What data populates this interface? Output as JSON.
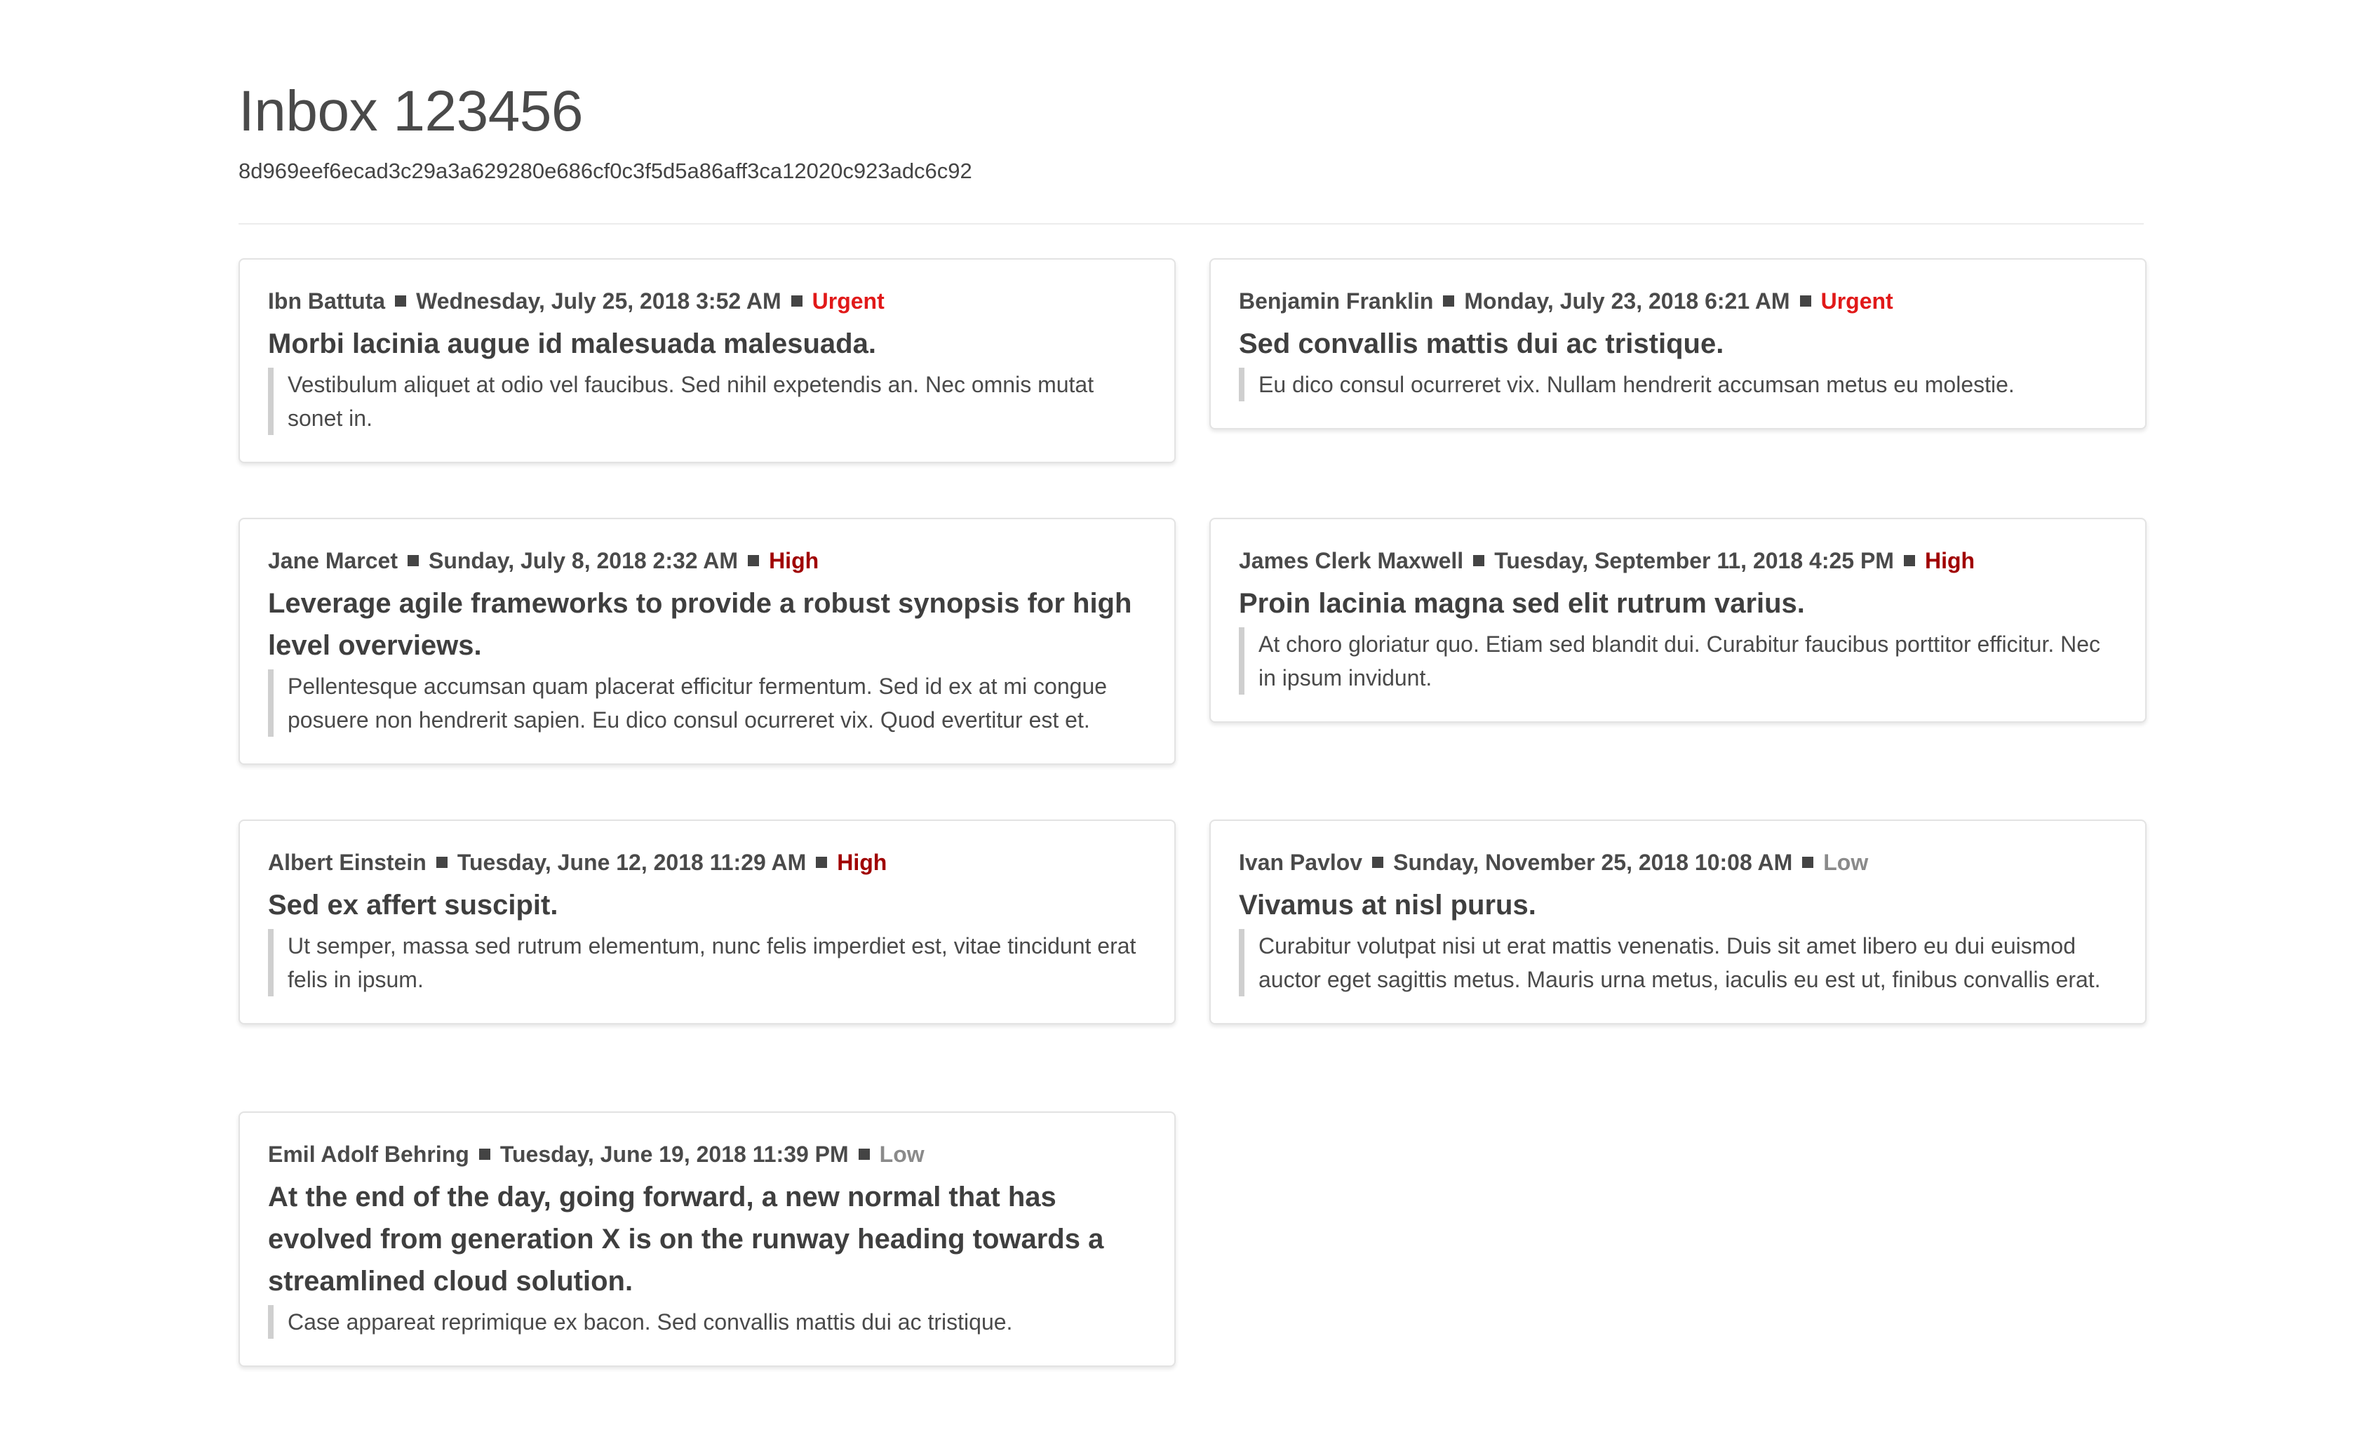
{
  "inbox": {
    "title": "Inbox 123456",
    "id": "8d969eef6ecad3c29a3a629280e686cf0c3f5d5a86aff3ca12020c923adc6c92"
  },
  "colors": {
    "urgent": "#e11919",
    "high": "#a00000",
    "low": "#8a8a8a"
  },
  "messages": [
    {
      "sender": "Ibn Battuta",
      "date": "Wednesday, July 25, 2018 3:52 AM",
      "priority": "Urgent",
      "subject": "Morbi lacinia augue id malesuada malesuada.",
      "snippet": "Vestibulum aliquet at odio vel faucibus. Sed nihil expetendis an. Nec omnis mutat sonet in."
    },
    {
      "sender": "Benjamin Franklin",
      "date": "Monday, July 23, 2018 6:21 AM",
      "priority": "Urgent",
      "subject": "Sed convallis mattis dui ac tristique.",
      "snippet": "Eu dico consul ocurreret vix. Nullam hendrerit accumsan metus eu molestie."
    },
    {
      "sender": "Jane Marcet",
      "date": "Sunday, July 8, 2018 2:32 AM",
      "priority": "High",
      "subject": "Leverage agile frameworks to provide a robust synopsis for high level overviews.",
      "snippet": "Pellentesque accumsan quam placerat efficitur fermentum. Sed id ex at mi congue posuere non hendrerit sapien. Eu dico consul ocurreret vix. Quod evertitur est et."
    },
    {
      "sender": "James Clerk Maxwell",
      "date": "Tuesday, September 11, 2018 4:25 PM",
      "priority": "High",
      "subject": "Proin lacinia magna sed elit rutrum varius.",
      "snippet": "At choro gloriatur quo. Etiam sed blandit dui. Curabitur faucibus porttitor efficitur. Nec in ipsum invidunt."
    },
    {
      "sender": "Albert Einstein",
      "date": "Tuesday, June 12, 2018 11:29 AM",
      "priority": "High",
      "subject": "Sed ex affert suscipit.",
      "snippet": "Ut semper, massa sed rutrum elementum, nunc felis imperdiet est, vitae tincidunt erat felis in ipsum."
    },
    {
      "sender": "Ivan Pavlov",
      "date": "Sunday, November 25, 2018 10:08 AM",
      "priority": "Low",
      "subject": "Vivamus at nisl purus.",
      "snippet": "Curabitur volutpat nisi ut erat mattis venenatis. Duis sit amet libero eu dui euismod auctor eget sagittis metus. Mauris urna metus, iaculis eu est ut, finibus convallis erat."
    },
    {
      "sender": "Emil Adolf Behring",
      "date": "Tuesday, June 19, 2018 11:39 PM",
      "priority": "Low",
      "subject": "At the end of the day, going forward, a new normal that has evolved from generation X is on the runway heading towards a streamlined cloud solution.",
      "snippet": "Case appareat reprimique ex bacon. Sed convallis mattis dui ac tristique."
    }
  ]
}
